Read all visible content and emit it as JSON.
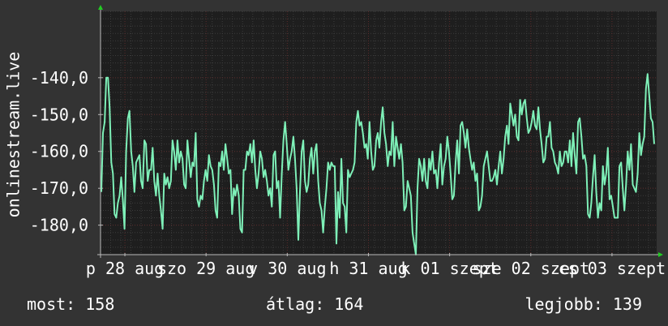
{
  "chart_data": {
    "type": "line",
    "ylabel": "onlinestream.live",
    "ylim": [
      -188,
      -122
    ],
    "y_ticks": [
      -140,
      -150,
      -160,
      -170,
      -180
    ],
    "y_tick_labels": [
      "-140,0",
      "-150,0",
      "-160,0",
      "-170,0",
      "-180,0"
    ],
    "x_tick_labels": [
      "p 28 aug",
      "szo 29 aug",
      "v 30 aug",
      "h 31 aug",
      "k 01 szept",
      "sze 02 szept",
      "cs 03 szept"
    ],
    "x_ticks": [
      0.3,
      1.3,
      2.3,
      3.3,
      4.3,
      5.3,
      6.3
    ],
    "xlim": [
      0,
      6.85
    ],
    "grid": true,
    "colors": {
      "background": "#333333",
      "plot_background": "#1e1e1e",
      "grid_major": "#5a2a2a",
      "grid_minor": "#3c3c3c",
      "line": "#7ef0b8",
      "axis": "#bbbbbb",
      "arrow": "#22cc22",
      "text": "#ffffff"
    },
    "series": [
      {
        "values": [
          -171,
          -155,
          -152,
          -140,
          -140,
          -148,
          -163,
          -166,
          -177,
          -178,
          -174,
          -172,
          -167,
          -173,
          -181,
          -160,
          -151,
          -149,
          -160,
          -164,
          -171,
          -163,
          -162,
          -161,
          -168,
          -170,
          -157,
          -158,
          -168,
          -165,
          -165,
          -159,
          -168,
          -172,
          -166,
          -172,
          -176,
          -181,
          -166,
          -169,
          -167,
          -170,
          -168,
          -157,
          -160,
          -165,
          -157,
          -163,
          -160,
          -162,
          -169,
          -170,
          -157,
          -162,
          -167,
          -163,
          -164,
          -155,
          -173,
          -175,
          -172,
          -173,
          -168,
          -165,
          -168,
          -161,
          -164,
          -165,
          -169,
          -176,
          -178,
          -163,
          -164,
          -160,
          -165,
          -158,
          -162,
          -166,
          -165,
          -177,
          -170,
          -172,
          -169,
          -172,
          -181,
          -182,
          -165,
          -165,
          -160,
          -161,
          -158,
          -163,
          -157,
          -165,
          -170,
          -166,
          -160,
          -162,
          -167,
          -165,
          -168,
          -172,
          -170,
          -175,
          -161,
          -160,
          -170,
          -168,
          -178,
          -166,
          -157,
          -152,
          -158,
          -165,
          -162,
          -160,
          -156,
          -162,
          -170,
          -184,
          -171,
          -160,
          -157,
          -168,
          -171,
          -169,
          -162,
          -159,
          -166,
          -160,
          -158,
          -168,
          -174,
          -176,
          -182,
          -175,
          -170,
          -163,
          -165,
          -163,
          -164,
          -164,
          -185,
          -171,
          -178,
          -162,
          -174,
          -175,
          -182,
          -165,
          -167,
          -166,
          -165,
          -163,
          -152,
          -149,
          -153,
          -152,
          -155,
          -159,
          -158,
          -162,
          -152,
          -160,
          -165,
          -164,
          -157,
          -155,
          -159,
          -152,
          -148,
          -155,
          -158,
          -164,
          -160,
          -161,
          -152,
          -164,
          -156,
          -159,
          -162,
          -158,
          -163,
          -176,
          -175,
          -168,
          -170,
          -172,
          -182,
          -185,
          -188,
          -170,
          -162,
          -164,
          -168,
          -162,
          -168,
          -170,
          -162,
          -165,
          -160,
          -166,
          -165,
          -170,
          -163,
          -158,
          -169,
          -164,
          -162,
          -156,
          -160,
          -166,
          -173,
          -172,
          -163,
          -157,
          -166,
          -153,
          -152,
          -155,
          -159,
          -154,
          -159,
          -162,
          -165,
          -163,
          -168,
          -166,
          -176,
          -175,
          -172,
          -164,
          -162,
          -160,
          -164,
          -168,
          -168,
          -167,
          -165,
          -169,
          -164,
          -160,
          -166,
          -162,
          -156,
          -153,
          -158,
          -147,
          -150,
          -153,
          -150,
          -156,
          -157,
          -146,
          -150,
          -147,
          -146,
          -151,
          -155,
          -154,
          -152,
          -149,
          -153,
          -154,
          -148,
          -154,
          -158,
          -163,
          -162,
          -156,
          -156,
          -152,
          -159,
          -160,
          -163,
          -164,
          -166,
          -160,
          -164,
          -163,
          -160,
          -160,
          -163,
          -157,
          -164,
          -155,
          -161,
          -166,
          -152,
          -151,
          -156,
          -162,
          -161,
          -164,
          -177,
          -178,
          -174,
          -167,
          -161,
          -171,
          -178,
          -174,
          -176,
          -164,
          -169,
          -166,
          -159,
          -173,
          -172,
          -175,
          -178,
          -178,
          -178,
          -164,
          -163,
          -170,
          -176,
          -169,
          -160,
          -165,
          -158,
          -169,
          -170,
          -171,
          -166,
          -155,
          -161,
          -158,
          -156,
          -143,
          -139,
          -145,
          -151,
          -152,
          -158
        ]
      }
    ]
  },
  "stats": {
    "now": "most: 158",
    "avg": "átlag: 164",
    "best": "legjobb: 139"
  }
}
